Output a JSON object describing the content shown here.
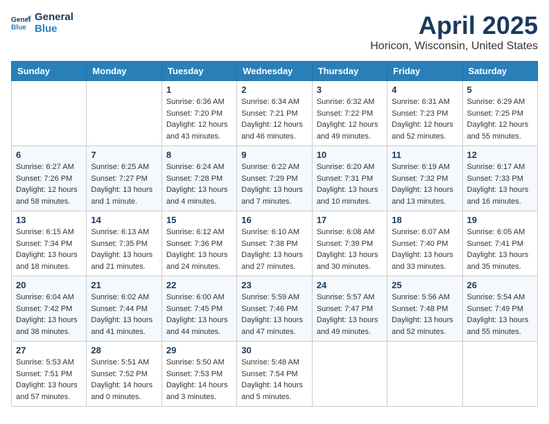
{
  "header": {
    "logo_line1": "General",
    "logo_line2": "Blue",
    "month": "April 2025",
    "location": "Horicon, Wisconsin, United States"
  },
  "weekdays": [
    "Sunday",
    "Monday",
    "Tuesday",
    "Wednesday",
    "Thursday",
    "Friday",
    "Saturday"
  ],
  "weeks": [
    [
      {
        "day": "",
        "sunrise": "",
        "sunset": "",
        "daylight": ""
      },
      {
        "day": "",
        "sunrise": "",
        "sunset": "",
        "daylight": ""
      },
      {
        "day": "1",
        "sunrise": "Sunrise: 6:36 AM",
        "sunset": "Sunset: 7:20 PM",
        "daylight": "Daylight: 12 hours and 43 minutes."
      },
      {
        "day": "2",
        "sunrise": "Sunrise: 6:34 AM",
        "sunset": "Sunset: 7:21 PM",
        "daylight": "Daylight: 12 hours and 46 minutes."
      },
      {
        "day": "3",
        "sunrise": "Sunrise: 6:32 AM",
        "sunset": "Sunset: 7:22 PM",
        "daylight": "Daylight: 12 hours and 49 minutes."
      },
      {
        "day": "4",
        "sunrise": "Sunrise: 6:31 AM",
        "sunset": "Sunset: 7:23 PM",
        "daylight": "Daylight: 12 hours and 52 minutes."
      },
      {
        "day": "5",
        "sunrise": "Sunrise: 6:29 AM",
        "sunset": "Sunset: 7:25 PM",
        "daylight": "Daylight: 12 hours and 55 minutes."
      }
    ],
    [
      {
        "day": "6",
        "sunrise": "Sunrise: 6:27 AM",
        "sunset": "Sunset: 7:26 PM",
        "daylight": "Daylight: 12 hours and 58 minutes."
      },
      {
        "day": "7",
        "sunrise": "Sunrise: 6:25 AM",
        "sunset": "Sunset: 7:27 PM",
        "daylight": "Daylight: 13 hours and 1 minute."
      },
      {
        "day": "8",
        "sunrise": "Sunrise: 6:24 AM",
        "sunset": "Sunset: 7:28 PM",
        "daylight": "Daylight: 13 hours and 4 minutes."
      },
      {
        "day": "9",
        "sunrise": "Sunrise: 6:22 AM",
        "sunset": "Sunset: 7:29 PM",
        "daylight": "Daylight: 13 hours and 7 minutes."
      },
      {
        "day": "10",
        "sunrise": "Sunrise: 6:20 AM",
        "sunset": "Sunset: 7:31 PM",
        "daylight": "Daylight: 13 hours and 10 minutes."
      },
      {
        "day": "11",
        "sunrise": "Sunrise: 6:19 AM",
        "sunset": "Sunset: 7:32 PM",
        "daylight": "Daylight: 13 hours and 13 minutes."
      },
      {
        "day": "12",
        "sunrise": "Sunrise: 6:17 AM",
        "sunset": "Sunset: 7:33 PM",
        "daylight": "Daylight: 13 hours and 16 minutes."
      }
    ],
    [
      {
        "day": "13",
        "sunrise": "Sunrise: 6:15 AM",
        "sunset": "Sunset: 7:34 PM",
        "daylight": "Daylight: 13 hours and 18 minutes."
      },
      {
        "day": "14",
        "sunrise": "Sunrise: 6:13 AM",
        "sunset": "Sunset: 7:35 PM",
        "daylight": "Daylight: 13 hours and 21 minutes."
      },
      {
        "day": "15",
        "sunrise": "Sunrise: 6:12 AM",
        "sunset": "Sunset: 7:36 PM",
        "daylight": "Daylight: 13 hours and 24 minutes."
      },
      {
        "day": "16",
        "sunrise": "Sunrise: 6:10 AM",
        "sunset": "Sunset: 7:38 PM",
        "daylight": "Daylight: 13 hours and 27 minutes."
      },
      {
        "day": "17",
        "sunrise": "Sunrise: 6:08 AM",
        "sunset": "Sunset: 7:39 PM",
        "daylight": "Daylight: 13 hours and 30 minutes."
      },
      {
        "day": "18",
        "sunrise": "Sunrise: 6:07 AM",
        "sunset": "Sunset: 7:40 PM",
        "daylight": "Daylight: 13 hours and 33 minutes."
      },
      {
        "day": "19",
        "sunrise": "Sunrise: 6:05 AM",
        "sunset": "Sunset: 7:41 PM",
        "daylight": "Daylight: 13 hours and 35 minutes."
      }
    ],
    [
      {
        "day": "20",
        "sunrise": "Sunrise: 6:04 AM",
        "sunset": "Sunset: 7:42 PM",
        "daylight": "Daylight: 13 hours and 38 minutes."
      },
      {
        "day": "21",
        "sunrise": "Sunrise: 6:02 AM",
        "sunset": "Sunset: 7:44 PM",
        "daylight": "Daylight: 13 hours and 41 minutes."
      },
      {
        "day": "22",
        "sunrise": "Sunrise: 6:00 AM",
        "sunset": "Sunset: 7:45 PM",
        "daylight": "Daylight: 13 hours and 44 minutes."
      },
      {
        "day": "23",
        "sunrise": "Sunrise: 5:59 AM",
        "sunset": "Sunset: 7:46 PM",
        "daylight": "Daylight: 13 hours and 47 minutes."
      },
      {
        "day": "24",
        "sunrise": "Sunrise: 5:57 AM",
        "sunset": "Sunset: 7:47 PM",
        "daylight": "Daylight: 13 hours and 49 minutes."
      },
      {
        "day": "25",
        "sunrise": "Sunrise: 5:56 AM",
        "sunset": "Sunset: 7:48 PM",
        "daylight": "Daylight: 13 hours and 52 minutes."
      },
      {
        "day": "26",
        "sunrise": "Sunrise: 5:54 AM",
        "sunset": "Sunset: 7:49 PM",
        "daylight": "Daylight: 13 hours and 55 minutes."
      }
    ],
    [
      {
        "day": "27",
        "sunrise": "Sunrise: 5:53 AM",
        "sunset": "Sunset: 7:51 PM",
        "daylight": "Daylight: 13 hours and 57 minutes."
      },
      {
        "day": "28",
        "sunrise": "Sunrise: 5:51 AM",
        "sunset": "Sunset: 7:52 PM",
        "daylight": "Daylight: 14 hours and 0 minutes."
      },
      {
        "day": "29",
        "sunrise": "Sunrise: 5:50 AM",
        "sunset": "Sunset: 7:53 PM",
        "daylight": "Daylight: 14 hours and 3 minutes."
      },
      {
        "day": "30",
        "sunrise": "Sunrise: 5:48 AM",
        "sunset": "Sunset: 7:54 PM",
        "daylight": "Daylight: 14 hours and 5 minutes."
      },
      {
        "day": "",
        "sunrise": "",
        "sunset": "",
        "daylight": ""
      },
      {
        "day": "",
        "sunrise": "",
        "sunset": "",
        "daylight": ""
      },
      {
        "day": "",
        "sunrise": "",
        "sunset": "",
        "daylight": ""
      }
    ]
  ]
}
